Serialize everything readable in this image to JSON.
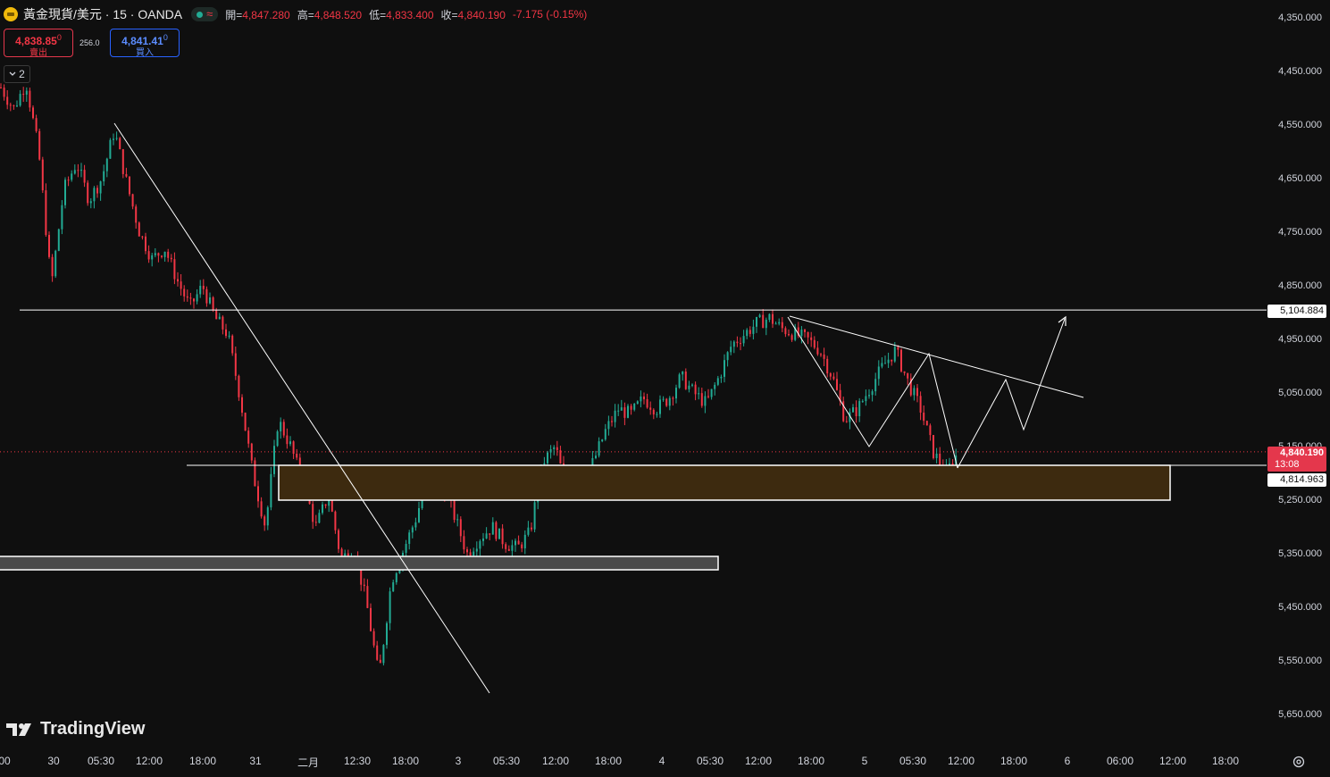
{
  "header": {
    "symbol": "黃金現貨/美元 · 15 · OANDA",
    "market_status_icon": "market-open-dot",
    "wave_icon": "≈",
    "open_label": "開=",
    "open": "4,847.280",
    "high_label": "高=",
    "high": "4,848.520",
    "low_label": "低=",
    "low": "4,833.400",
    "close_label": "收=",
    "close": "4,840.190",
    "change": "-7.175 (-0.15%)"
  },
  "trade": {
    "sell_price": "4,838.85",
    "sell_price_sup": "0",
    "sell_label": "賣出",
    "spread": "256.0",
    "buy_price": "4,841.41",
    "buy_price_sup": "0",
    "buy_label": "買入"
  },
  "indicators": {
    "count": "2"
  },
  "price_axis": {
    "ticks": [
      "5,650.000",
      "5,550.000",
      "5,450.000",
      "5,350.000",
      "5,250.000",
      "5,150.000",
      "5,050.000",
      "4,950.000",
      "4,850.000",
      "4,750.000",
      "4,650.000",
      "4,550.000",
      "4,450.000",
      "4,350.000"
    ]
  },
  "tags": {
    "resistance": "5,104.884",
    "last_price": "4,840.190",
    "countdown": "13:08",
    "zone_top": "4,814.963"
  },
  "time_axis": {
    "labels": [
      "00",
      "30",
      "05:30",
      "12:00",
      "18:00",
      "31",
      "二月",
      "12:30",
      "18:00",
      "3",
      "05:30",
      "12:00",
      "18:00",
      "4",
      "05:30",
      "12:00",
      "18:00",
      "5",
      "05:30",
      "12:00",
      "18:00",
      "6",
      "06:00",
      "12:00",
      "18:00"
    ]
  },
  "brand": "TradingView",
  "colors": {
    "background": "#0f0f0f",
    "up": "#22ab94",
    "down": "#f23645",
    "zone_brown": "#3d2a0f",
    "zone_gray": "#4a4a4a",
    "drawings": "#ffffff"
  },
  "chart_data": {
    "type": "candlestick",
    "symbol": "XAU/USD",
    "interval": "15",
    "y_scale": "price",
    "ylim": [
      4300,
      5700
    ],
    "y_ticks": [
      4350,
      4450,
      4550,
      4650,
      4750,
      4850,
      4950,
      5050,
      5150,
      5250,
      5350,
      5450,
      5550,
      5650
    ],
    "price_path": [
      [
        "30 00:00",
        5520
      ],
      [
        "30 03:00",
        5480
      ],
      [
        "30 05:00",
        5530
      ],
      [
        "30 07:00",
        5400
      ],
      [
        "30 09:00",
        5150
      ],
      [
        "30 10:30",
        5330
      ],
      [
        "30 12:00",
        5380
      ],
      [
        "30 13:30",
        5310
      ],
      [
        "30 14:30",
        5350
      ],
      [
        "30 15:30",
        5440
      ],
      [
        "30 17:00",
        5340
      ],
      [
        "30 18:00",
        5250
      ],
      [
        "30 19:30",
        5200
      ],
      [
        "30 21:00",
        5220
      ],
      [
        "30 22:30",
        5160
      ],
      [
        "31 00:00",
        5110
      ],
      [
        "31 01:30",
        5150
      ],
      [
        "31 03:00",
        5090
      ],
      [
        "31 04:30",
        5060
      ],
      [
        "31 06:00",
        4940
      ],
      [
        "31 07:30",
        4800
      ],
      [
        "31 08:30",
        4700
      ],
      [
        "31 10:00",
        4900
      ],
      [
        "31 11:00",
        4850
      ],
      [
        "31 13:00",
        4780
      ],
      [
        "31 14:00",
        4700
      ],
      [
        "31 15:30",
        4760
      ],
      [
        "31 16:30",
        4640
      ],
      [
        "31 17:30",
        4660
      ],
      [
        "31 18:30",
        4560
      ],
      [
        "31 19:30",
        4420
      ],
      [
        "31 20:30",
        4600
      ],
      [
        "31 21:30",
        4660
      ],
      [
        "31 22:30",
        4720
      ],
      [
        "31 23:30",
        4810
      ],
      [
        "二月 01:00",
        4780
      ],
      [
        "二月 02:00",
        4720
      ],
      [
        "二月 03:30",
        4650
      ],
      [
        "二月 05:00",
        4680
      ],
      [
        "二月 06:30",
        4700
      ],
      [
        "二月 07:30",
        4670
      ],
      [
        "二月 09:00",
        4660
      ],
      [
        "二月 10:00",
        4690
      ],
      [
        "二月 11:00",
        4820
      ],
      [
        "二月 12:30",
        4850
      ],
      [
        "二月 14:00",
        4760
      ],
      [
        "二月 15:00",
        4790
      ],
      [
        "二月 17:00",
        4820
      ],
      [
        "二月 18:00",
        4880
      ],
      [
        "二月 19:30",
        4920
      ],
      [
        "二月 21:00",
        4910
      ],
      [
        "二月 23:00",
        4940
      ],
      [
        "3 01:00",
        4920
      ],
      [
        "3 03:00",
        4940
      ],
      [
        "3 05:00",
        4980
      ],
      [
        "3 06:30",
        4950
      ],
      [
        "3 08:30",
        4930
      ],
      [
        "3 10:00",
        4980
      ],
      [
        "3 11:30",
        5040
      ],
      [
        "3 13:00",
        5060
      ],
      [
        "3 14:30",
        5080
      ],
      [
        "3 16:00",
        5090
      ],
      [
        "3 17:00",
        5070
      ],
      [
        "3 18:30",
        5060
      ],
      [
        "3 20:00",
        5050
      ],
      [
        "3 22:00",
        5030
      ],
      [
        "4 00:00",
        4980
      ],
      [
        "4 01:00",
        4900
      ],
      [
        "4 02:30",
        4920
      ],
      [
        "4 04:00",
        4960
      ],
      [
        "4 05:00",
        5000
      ],
      [
        "4 06:30",
        5030
      ],
      [
        "4 07:30",
        4970
      ],
      [
        "4 08:30",
        4920
      ],
      [
        "4 09:30",
        4840
      ],
      [
        "4 10:30",
        4800
      ],
      [
        "4 11:00",
        4840
      ]
    ],
    "annotations": {
      "horizontal_lines": [
        5104.884,
        4814.963
      ],
      "zones": [
        [
          4750,
          4815
        ],
        [
          4620,
          4645
        ]
      ],
      "last_price": 4840.19
    }
  }
}
